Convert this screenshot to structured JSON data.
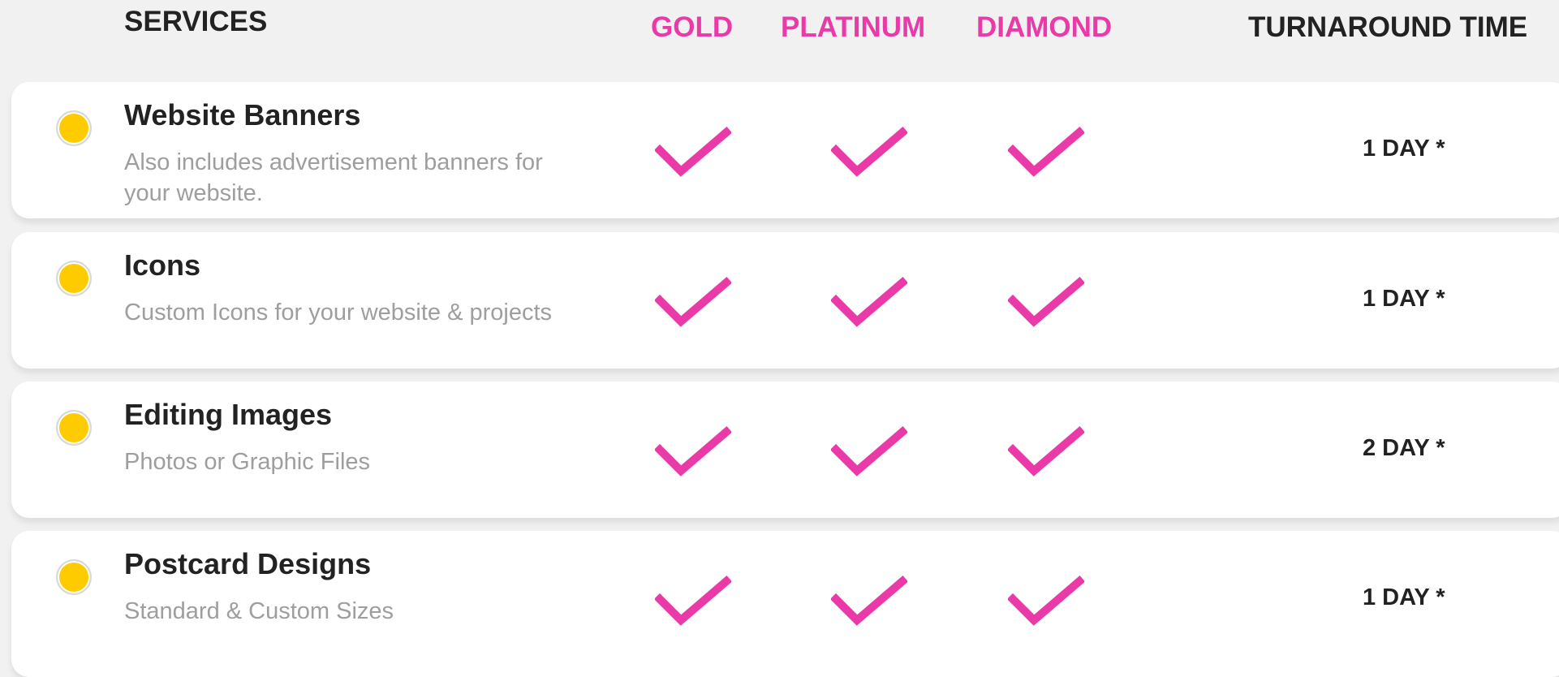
{
  "header": {
    "services": "SERVICES",
    "gold": "GOLD",
    "platinum": "PLATINUM",
    "diamond": "DIAMOND",
    "turnaround": "TURNAROUND TIME"
  },
  "colors": {
    "accent_pink": "#e93aa8",
    "bullet_yellow": "#fecb00",
    "text_dark": "#222222",
    "text_muted": "#9e9e9e"
  },
  "rows": [
    {
      "title": "Website Banners",
      "description": "Also includes advertisement banners for your website.",
      "gold": "check-icon",
      "platinum": "check-icon",
      "diamond": "check-icon",
      "turnaround": "1 DAY *"
    },
    {
      "title": "Icons",
      "description": "Custom Icons for your website & projects",
      "gold": "check-icon",
      "platinum": "check-icon",
      "diamond": "check-icon",
      "turnaround": "1 DAY *"
    },
    {
      "title": "Editing Images",
      "description": "Photos or Graphic Files",
      "gold": "check-icon",
      "platinum": "check-icon",
      "diamond": "check-icon",
      "turnaround": "2 DAY *"
    },
    {
      "title": "Postcard Designs",
      "description": "Standard & Custom Sizes",
      "gold": "check-icon",
      "platinum": "check-icon",
      "diamond": "check-icon",
      "turnaround": "1 DAY *"
    }
  ]
}
